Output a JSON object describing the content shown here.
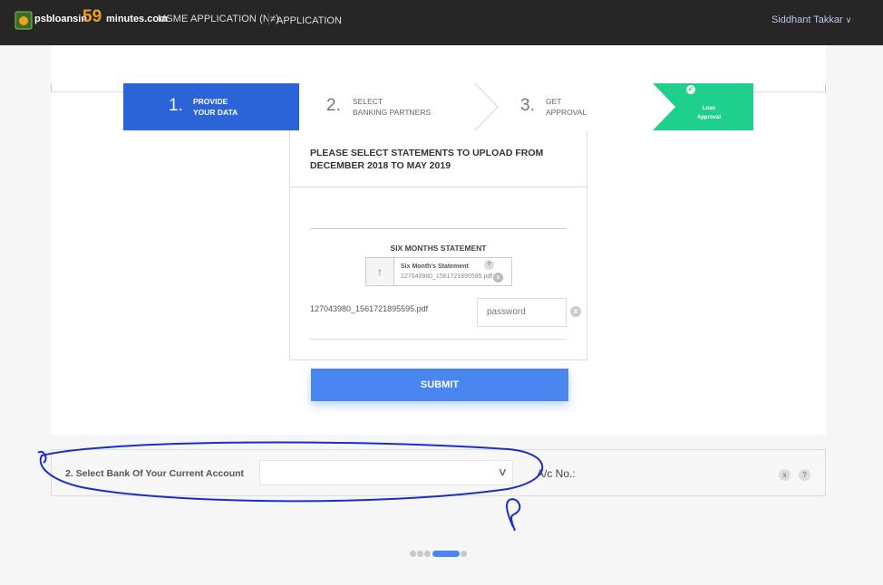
{
  "topbar": {
    "logo_text_a": "psbloansin",
    "logo_number": "59",
    "logo_text_b": "minutes.com",
    "nav_msme": "MSME APPLICATION (N≠)",
    "nav_application": "APPLICATION",
    "user_name": "Siddhant Takkar",
    "colors": {
      "bar": "#262626",
      "logo_accent": "#f0a021"
    }
  },
  "steps": [
    {
      "number": "1.",
      "label_line1": "PROVIDE",
      "label_line2": "YOUR DATA",
      "state": "active"
    },
    {
      "number": "2.",
      "label_line1": "SELECT",
      "label_line2": "BANKING PARTNERS",
      "state": "pending"
    },
    {
      "number": "3.",
      "label_line1": "GET",
      "label_line2": "APPROVAL",
      "state": "pending"
    },
    {
      "label_line1": "Loan",
      "label_line2": "Approval",
      "state": "final"
    }
  ],
  "statement_card": {
    "heading": "PLEASE SELECT STATEMENTS TO UPLOAD FROM DECEMBER 2018 TO MAY 2019",
    "section_title": "SIX MONTHS STATEMENT",
    "upload_title": "Six Month's Statement",
    "upload_filename": "127043980_1561721895595.pdf",
    "file_name": "127043980_1561721895595.pdf",
    "password_placeholder": "password"
  },
  "submit_label": "SUBMIT",
  "bank_row": {
    "label": "2. Select Bank Of Your Current Account",
    "select_value": "",
    "ac_label": "A/c No.:"
  },
  "icons": {
    "upload": "↑",
    "help": "?",
    "remove": "x",
    "check": "✔",
    "chevron": "∨"
  },
  "pagination": {
    "count": 5,
    "active_index": 3
  },
  "colors": {
    "primary": "#2b63d9",
    "success": "#1ed08b",
    "submit": "#4a86f0",
    "annotation": "#1a2fc4"
  }
}
